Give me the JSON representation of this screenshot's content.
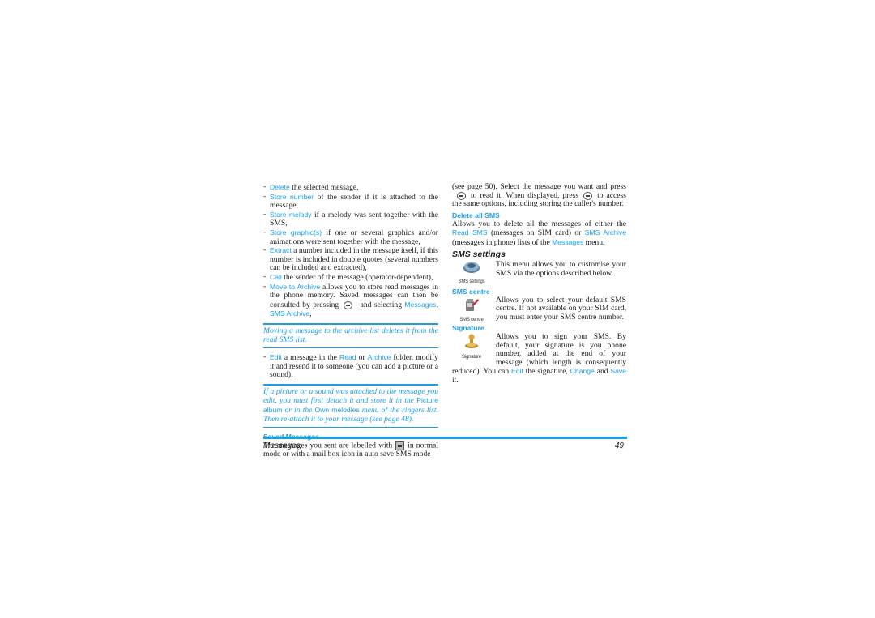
{
  "left_column": {
    "bullets": [
      {
        "link": "Delete",
        "text": " the selected message,"
      },
      {
        "link": "Store number",
        "text": " of the sender if it is attached to the message,"
      },
      {
        "link": "Store melody",
        "text": " if a melody was sent together with the SMS,"
      },
      {
        "link": "Store graphic(s)",
        "text": " if one or several graphics and/or animations were sent together with the message,"
      },
      {
        "link": "Extract",
        "text": " a number included in the message itself, if this number is included in double quotes (several numbers can be included and extracted),"
      },
      {
        "link": "Call",
        "text": " the sender of the message (operator-dependent),"
      }
    ],
    "archive_bullet": {
      "link": "Move to Archive",
      "text_before_icon": " allows you to store read messages in the phone memory. Saved messages can then be consulted by pressing",
      "icon": "ok-key-icon",
      "text_after_icon": " and selecting ",
      "link2": "Messages",
      "sep": ", ",
      "link3": "SMS Archive",
      "end": ","
    },
    "note1": "Moving a message to the archive list deletes it from the read SMS list.",
    "edit_bullet": {
      "link": "Edit",
      "t1": " a message in the ",
      "link2": "Read",
      "t2": " or ",
      "link3": "Archive",
      "t3": " folder, modify it and resend it to someone (you can add a picture or a sound)."
    },
    "note2": {
      "t1": "If a picture or a sound was attached to the message you edit, you must first detach it and store it in the ",
      "hl1": "Picture album",
      "t2": " or in the ",
      "hl2": "Own melodies",
      "t3": " menu of the ringers list. Then re-attach it to your message (see page 48)."
    },
    "saved_heading": "Saved Messages",
    "saved_text_before_icon": "The messages you sent are labelled with",
    "saved_icon": "sent-message-icon",
    "saved_text_after_icon": "in normal mode or with a mail box icon in auto save SMS mode"
  },
  "right_column": {
    "intro": {
      "t1": "(see page 50). Select the message you want and press",
      "icon1": "ok-key-icon",
      "t2": "to read it. When displayed, press",
      "icon2": "ok-key-icon",
      "t3": "to access the same options, including storing the caller's number."
    },
    "delete_all_heading": "Delete all SMS",
    "delete_all": {
      "t1": "Allows you to delete all the messages of either the ",
      "link1": "Read SMS",
      "t2": " (messages on SIM card) or ",
      "link2": "SMS Archive",
      "t3": " (messages in phone) lists of the ",
      "link3": "Messages",
      "t4": " menu."
    },
    "sms_settings_heading": "SMS settings",
    "sms_settings_icon_caption": "SMS settings",
    "sms_settings_text": "This menu allows you to customise your SMS via the options described below.",
    "sms_centre_heading": "SMS centre",
    "sms_centre_icon_caption": "SMS centre",
    "sms_centre_text": "Allows you to select your default SMS centre. If not available on your SIM card, you must enter your SMS centre number.",
    "signature_heading": "Signature",
    "signature_icon_caption": "Signature",
    "signature_text": {
      "t1": "Allows you to sign your SMS. By default, your signature is you phone number, added at the end of your message (which length is consequently reduced). You can ",
      "link1": "Edit",
      "t2": " the signature, ",
      "link2": "Change",
      "t3": " and ",
      "link3": "Save",
      "t4": " it."
    }
  },
  "footer": {
    "section": "Messages",
    "page_number": "49"
  },
  "colors": {
    "accent": "#1a9ee6",
    "text": "#1a1a1a"
  }
}
